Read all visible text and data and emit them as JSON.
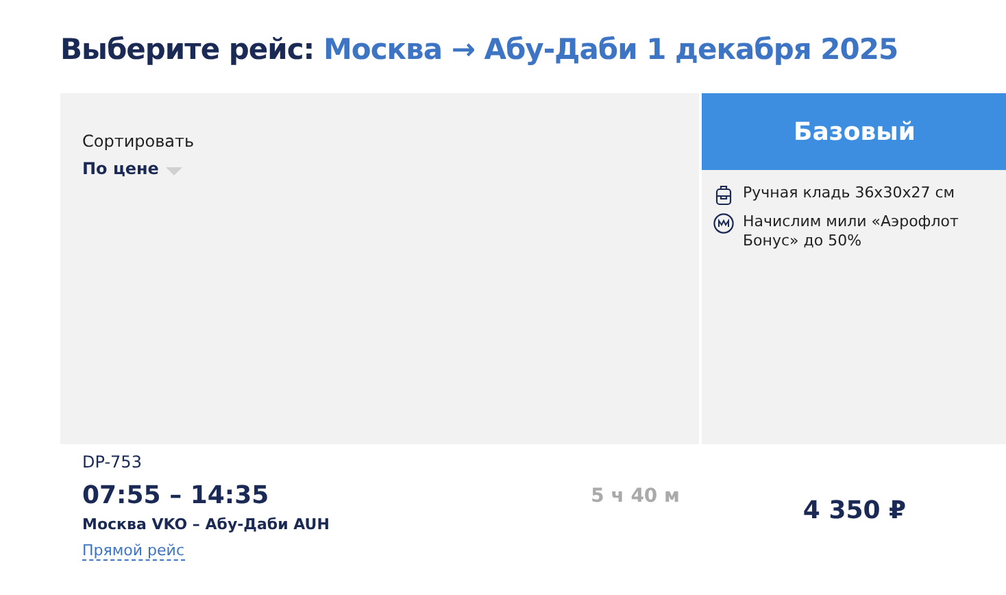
{
  "heading": {
    "label": "Выберите рейс:",
    "route": "Москва → Абу-Даби 1 декабря 2025"
  },
  "sort": {
    "label": "Сортировать",
    "value": "По цене"
  },
  "fare": {
    "title": "Базовый",
    "features": [
      {
        "kind": "bag",
        "text": "Ручная кладь 36x30x27 см"
      },
      {
        "kind": "miles",
        "text": "Начислим мили «Аэрофлот Бонус» до 50%"
      }
    ]
  },
  "flights": [
    {
      "number": "DP-753",
      "times": "07:55 – 14:35",
      "duration": "5 ч 40 м",
      "route": "Москва VKO – Абу-Даби AUH",
      "type": "Прямой рейс",
      "price": "4 350 ₽"
    }
  ]
}
